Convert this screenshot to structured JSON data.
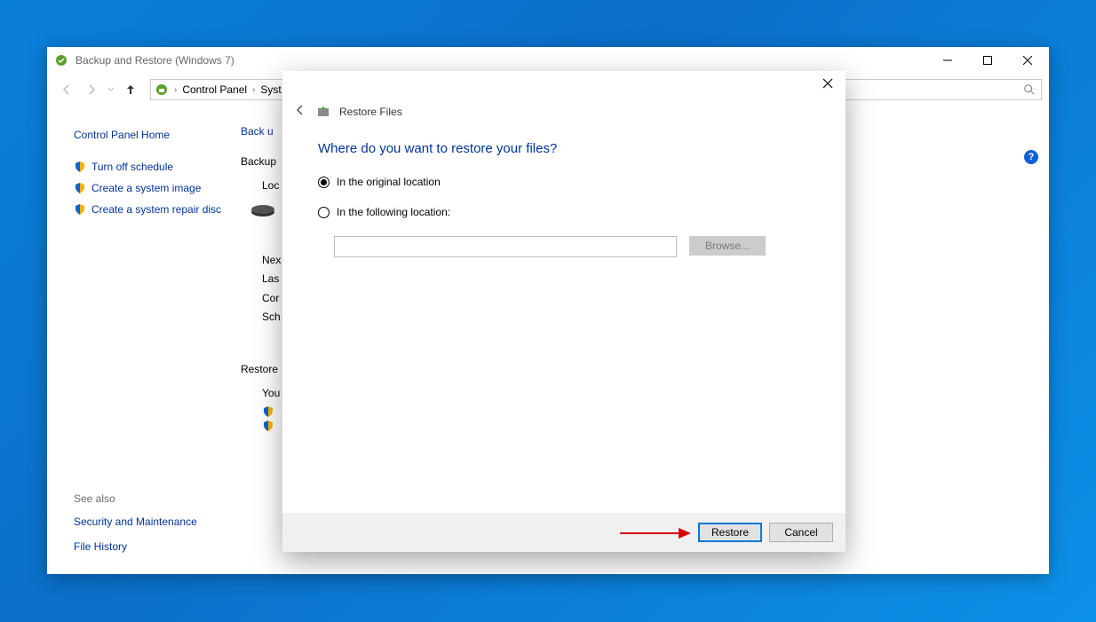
{
  "window": {
    "title": "Backup and Restore (Windows 7)"
  },
  "breadcrumb": {
    "root": "Control Panel",
    "next": "Syst"
  },
  "sidebar": {
    "home": "Control Panel Home",
    "tasks": [
      {
        "label": "Turn off schedule"
      },
      {
        "label": "Create a system image"
      },
      {
        "label": "Create a system repair disc"
      }
    ],
    "see_also_heading": "See also",
    "see_also_links": [
      "Security and Maintenance",
      "File History"
    ]
  },
  "content": {
    "heading_partial": "Back u",
    "backup_label": "Backup",
    "loc_label": "Loc",
    "status_lines": [
      "Nex",
      "Las",
      "Cor",
      "Sch"
    ],
    "restore_label": "Restore",
    "you_label": "You"
  },
  "dialog": {
    "title": "Restore Files",
    "heading": "Where do you want to restore your files?",
    "radio_original": "In the original location",
    "radio_following": "In the following location:",
    "browse_label": "Browse...",
    "restore_label": "Restore",
    "cancel_label": "Cancel"
  }
}
